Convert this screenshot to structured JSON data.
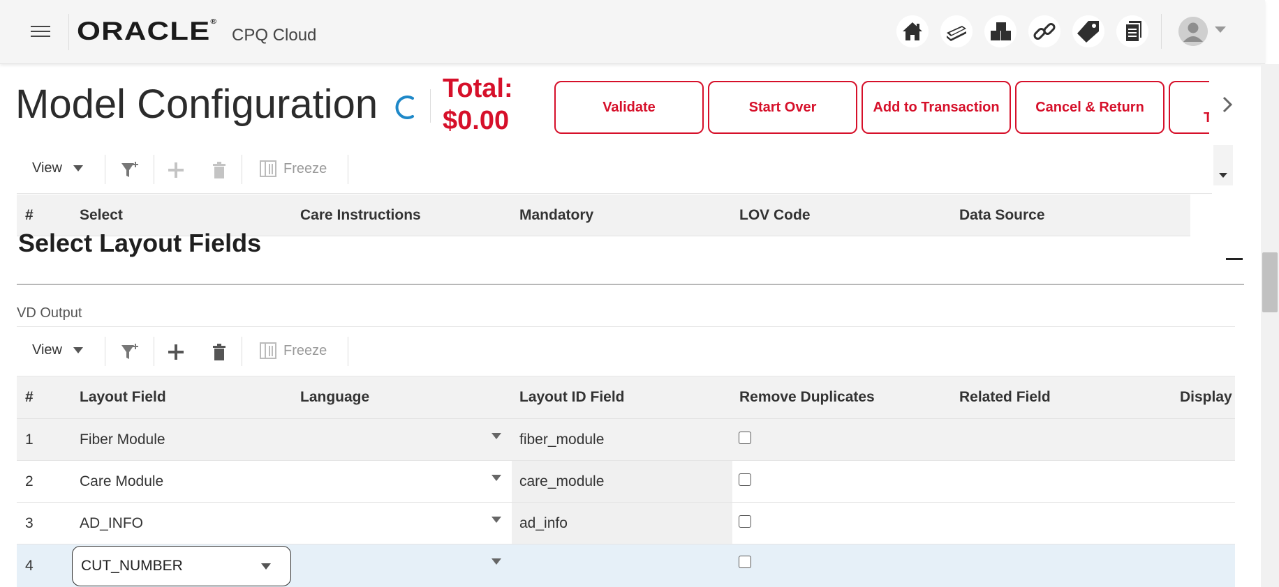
{
  "header": {
    "logo": "ORACLE",
    "logo_mark": "®",
    "product": "CPQ Cloud",
    "nav_icons": [
      "home-icon",
      "money-icon",
      "products-icon",
      "link-icon",
      "tag-icon",
      "documents-icon"
    ],
    "avatar_icon": "user-avatar-icon"
  },
  "titlebar": {
    "title": "Model Configuration",
    "total_label": "Total:",
    "total_value": "$0.00",
    "actions": [
      {
        "label": "Validate"
      },
      {
        "label": "Start Over"
      },
      {
        "label": "Add to Transaction"
      },
      {
        "label": "Cancel & Return"
      },
      {
        "label": "T"
      }
    ],
    "accent_color": "#d6102a"
  },
  "upper_table": {
    "toolbar": {
      "view": "View",
      "freeze": "Freeze"
    },
    "columns": [
      "#",
      "Select",
      "Care Instructions",
      "Mandatory",
      "LOV Code",
      "Data Source"
    ]
  },
  "section": {
    "title": "Select Layout Fields",
    "subtitle": "VD Output"
  },
  "lower_table": {
    "toolbar": {
      "view": "View",
      "freeze": "Freeze"
    },
    "columns": [
      "#",
      "Layout Field",
      "Language",
      "Layout ID Field",
      "Remove Duplicates",
      "Related Field",
      "Display"
    ],
    "rows": [
      {
        "num": "1",
        "layout_field": "Fiber Module",
        "language": "",
        "layout_id": "fiber_module",
        "remove_duplicates": false
      },
      {
        "num": "2",
        "layout_field": "Care Module",
        "language": "",
        "layout_id": "care_module",
        "remove_duplicates": false
      },
      {
        "num": "3",
        "layout_field": "AD_INFO",
        "language": "",
        "layout_id": "ad_info",
        "remove_duplicates": false
      },
      {
        "num": "4",
        "layout_field": "CUT_NUMBER",
        "language": "",
        "layout_id": "",
        "remove_duplicates": false
      }
    ]
  }
}
